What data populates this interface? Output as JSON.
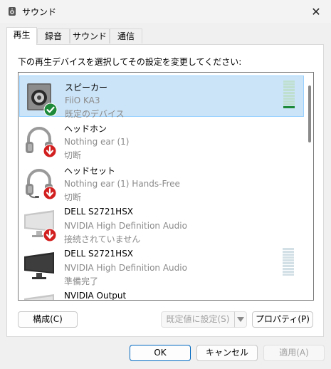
{
  "window": {
    "title": "サウンド",
    "close_glyph": "✕"
  },
  "tabs": [
    {
      "label": "再生"
    },
    {
      "label": "録音"
    },
    {
      "label": "サウンド"
    },
    {
      "label": "通信"
    }
  ],
  "instruction": "下の再生デバイスを選択してその設定を変更してください:",
  "devices": [
    {
      "name": "スピーカー",
      "description": "FiiO KA3",
      "status": "既定のデバイス",
      "icon": "speaker-icon",
      "badge": "check-badge-icon"
    },
    {
      "name": "ヘッドホン",
      "description": "Nothing ear (1)",
      "status": "切断",
      "icon": "headphones-icon",
      "badge": "disconnected-badge-icon"
    },
    {
      "name": "ヘッドセット",
      "description": "Nothing ear (1) Hands-Free",
      "status": "切断",
      "icon": "headset-icon",
      "badge": "disconnected-badge-icon"
    },
    {
      "name": "DELL S2721HSX",
      "description": "NVIDIA High Definition Audio",
      "status": "接続されていません",
      "icon": "monitor-icon",
      "badge": "disconnected-badge-icon"
    },
    {
      "name": "DELL S2721HSX",
      "description": "NVIDIA High Definition Audio",
      "status": "準備完了",
      "icon": "monitor-icon",
      "badge": ""
    },
    {
      "name": "NVIDIA Output",
      "description": "",
      "status": "",
      "icon": "monitor-icon",
      "badge": ""
    }
  ],
  "buttons": {
    "configure": "構成(C)",
    "set_default": "既定値に設定(S)",
    "properties": "プロパティ(P)",
    "ok": "OK",
    "cancel": "キャンセル",
    "apply": "適用(A)"
  },
  "colors": {
    "selection": "#cce4f7",
    "accent": "#0067c0",
    "ok_green": "#1c8a3a",
    "error_red": "#d21f1f"
  }
}
